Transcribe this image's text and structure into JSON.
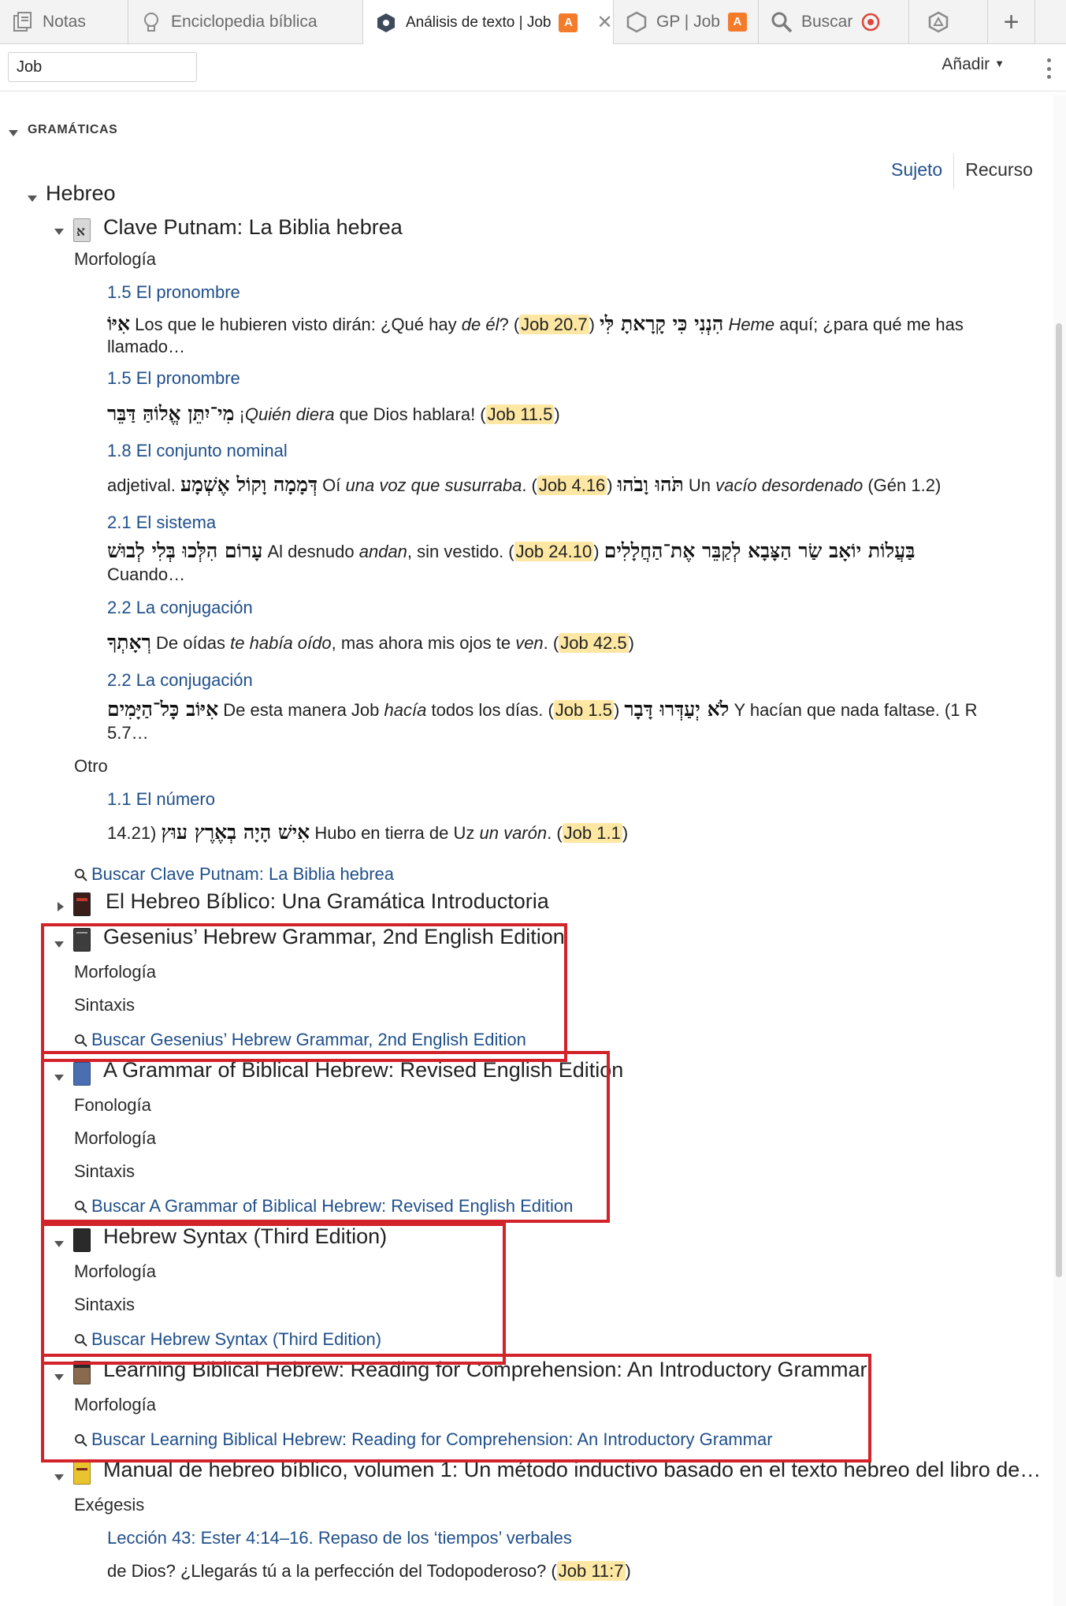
{
  "tabs": [
    {
      "label": "Notas",
      "icon": "notes-icon"
    },
    {
      "label": "Enciclopedia bíblica",
      "icon": "lightbulb-icon"
    },
    {
      "label": "Análisis de texto | Job",
      "icon": "text-analysis-icon",
      "badge": "A",
      "active": true,
      "close": "✕"
    },
    {
      "label": "GP | Job",
      "icon": "passage-guide-icon",
      "badge": "A"
    },
    {
      "label": "Buscar",
      "icon": "search-icon"
    },
    {
      "label": "",
      "icon": "factbook-icon"
    }
  ],
  "add_tab": "+",
  "toolbar": {
    "reference_value": "Job",
    "add_label": "Añadir"
  },
  "section_title": "GRAMÁTICAS",
  "view_switch": {
    "subject": "Sujeto",
    "resource": "Recurso"
  },
  "colors": {
    "link": "#1f4f8a",
    "reference_highlight": "#fde7a3",
    "annotation_box": "#d2232a",
    "badge": "#f47b2a"
  },
  "language": "Hebreo",
  "putnam": {
    "title": "Clave Putnam: La Biblia hebrea",
    "cat_morph": "Morfología",
    "e1": {
      "title": "1.5 El pronombre",
      "heb": "אִיּוֹ",
      "t1": "Los que le hubieren visto dirán: ¿Qué hay",
      "i1": "de él",
      "t2": "? (",
      "ref": "Job 20.7",
      "t3": ")",
      "heb2": "הִנְנִי כִּי קָרָאתָ לִּי",
      "i2": "Heme",
      "t4": "aquí; ¿para qué me has",
      "cont": "llamado…"
    },
    "e2": {
      "title": "1.5 El pronombre",
      "heb": "מִי־יִתֵּן אֱלוֹהַּ דַּבֵּר",
      "t1": "¡",
      "i1": "Quién diera",
      "t2": "que Dios hablara! (",
      "ref": "Job 11.5",
      "t3": ")"
    },
    "e3": {
      "title": "1.8 El conjunto nominal",
      "t0": "adjetival.",
      "heb": "דְּמָמָה וָקוֹל אֶשְׁמָע",
      "t1": "Oí",
      "i1": "una voz que susurraba",
      "t2": ". (",
      "ref": "Job 4.16",
      "t3": ")",
      "heb2": "תֹּהוּ וָבֹהוּ",
      "t4": "Un",
      "i2": "vacío desordenado",
      "t5": "(Gén 1.2)"
    },
    "e4": {
      "title": "2.1 El sistema",
      "heb": "עָרוֹם הִלְּכוּ בְּלִי לְבוּשׁ",
      "t1": "Al desnudo",
      "i1": "andan",
      "t2": ", sin vestido. (",
      "ref": "Job 24.10",
      "t3": ")",
      "heb2": "בַּעֲלוֹת יוֹאָב שַׂר הַצָּבָא לְקַבֵּר אֶת־הַחֲלָלִים",
      "cont": "Cuando…"
    },
    "e5": {
      "title": "2.2 La conjugación",
      "heb": "רְאָתְךָ",
      "t1": "De oídas",
      "i1": "te había oído",
      "t2": ", mas ahora mis ojos te",
      "i2": "ven",
      "t3": ". (",
      "ref": "Job 42.5",
      "t4": ")"
    },
    "e6": {
      "title": "2.2 La conjugación",
      "heb": "אִיּוֹב כָּל־הַיָּמִים",
      "t1": "De esta manera Job",
      "i1": "hacía",
      "t2": "todos los días. (",
      "ref": "Job 1.5",
      "t3": ")",
      "heb2": "לֹא יְעַדְּרוּ דָּבָר",
      "t4": "Y hacían que nada faltase. (1 R",
      "cont": "5.7…"
    },
    "cat_other": "Otro",
    "e7": {
      "title": "1.1 El número",
      "t0": "14.21)",
      "heb": "אִישׁ הָיָה בְאֶרֶץ עוּץ",
      "t1": "Hubo en tierra de Uz",
      "i1": "un varón",
      "t2": ". (",
      "ref": "Job 1.1",
      "t3": ")"
    },
    "search": "Buscar Clave Putnam: La Biblia hebrea"
  },
  "hebreo_biblico": {
    "title": "El Hebreo Bíblico: Una Gramática Introductoria"
  },
  "gesenius": {
    "title": "Gesenius’ Hebrew Grammar, 2nd English Edition",
    "c1": "Morfología",
    "c2": "Sintaxis",
    "search": "Buscar Gesenius’ Hebrew Grammar, 2nd English Edition"
  },
  "gbh": {
    "title": "A Grammar of Biblical Hebrew: Revised English Edition",
    "c1": "Fonología",
    "c2": "Morfología",
    "c3": "Sintaxis",
    "search": "Buscar A Grammar of Biblical Hebrew: Revised English Edition"
  },
  "syntax": {
    "title": "Hebrew Syntax (Third Edition)",
    "c1": "Morfología",
    "c2": "Sintaxis",
    "search": "Buscar Hebrew Syntax (Third Edition)"
  },
  "lbh": {
    "title": "Learning Biblical Hebrew: Reading for Comprehension: An Introductory Grammar",
    "c1": "Morfología",
    "search": "Buscar Learning Biblical Hebrew: Reading for Comprehension: An Introductory Grammar"
  },
  "manual": {
    "title": "Manual de hebreo bíblico, volumen 1: Un método inductivo basado en el texto hebreo del libro de…",
    "c1": "Exégesis",
    "e1_title": "Lección 43: Ester 4:14–16. Repaso de los ‘tiempos’ verbales",
    "e1_t1": "de Dios? ¿Llegarás tú a la perfección del Todopoderoso? (",
    "e1_ref": "Job 11:7",
    "e1_t2": ")"
  }
}
